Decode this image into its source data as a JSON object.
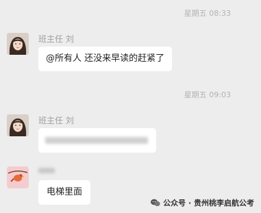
{
  "messages": [
    {
      "time": "星期五 08:33",
      "sender": "班主任 刘",
      "text": "@所有人 还没来早读的赶紧了"
    },
    {
      "time": "星期五 09:03",
      "sender": "班主任 刘",
      "text": ""
    },
    {
      "time": "",
      "sender": "",
      "text": "电梯里面"
    }
  ],
  "watermark": {
    "icon": "wechat-official-account-icon",
    "text": "公众号 · 贵州桃李启航公考"
  },
  "colors": {
    "background": "#ededed",
    "bubble": "#ffffff",
    "timestamp": "#b2b2b2"
  }
}
